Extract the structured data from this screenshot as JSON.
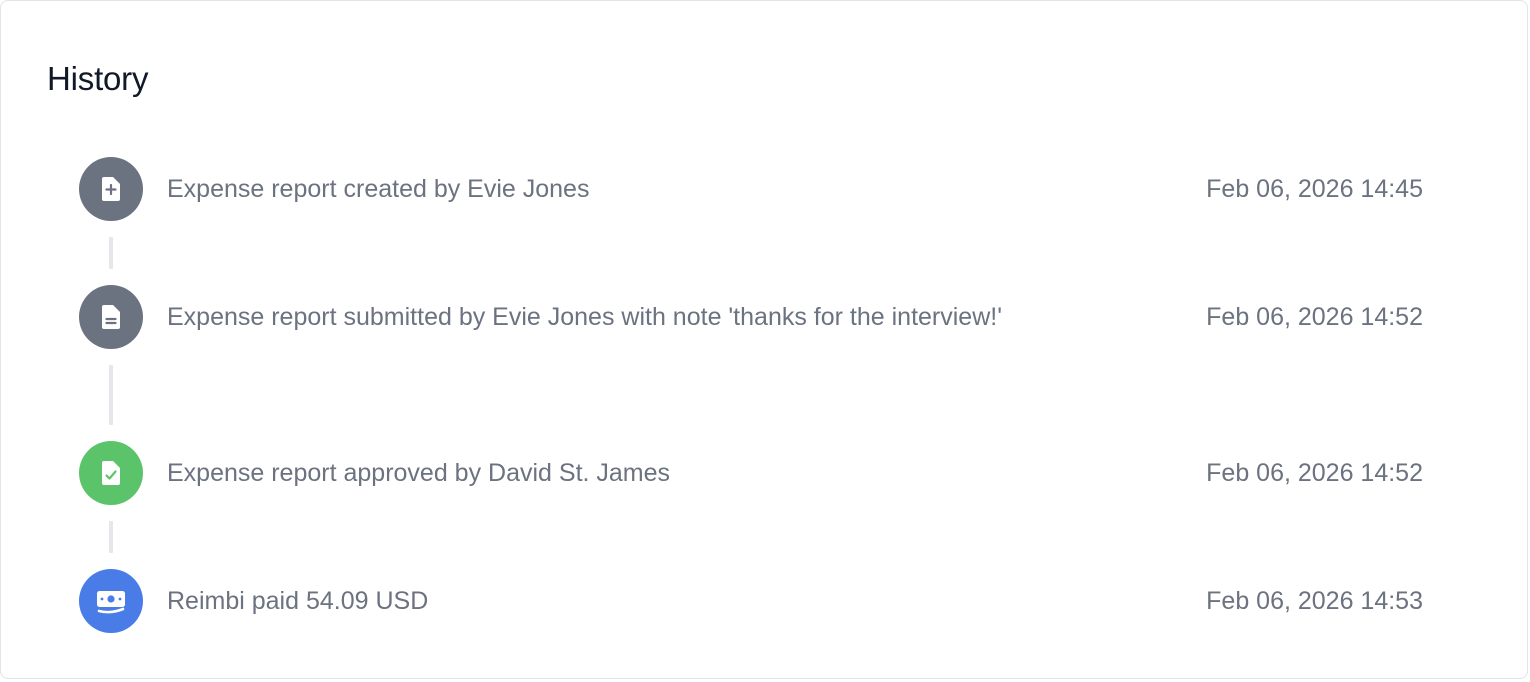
{
  "history": {
    "title": "History",
    "events": [
      {
        "text": "Expense report created by Evie Jones",
        "timestamp": "Feb 06, 2026 14:45",
        "icon": "document-add-icon",
        "icon_color": "#6b7280"
      },
      {
        "text": "Expense report submitted by Evie Jones with note 'thanks for the interview!'",
        "timestamp": "Feb 06, 2026 14:52",
        "icon": "document-text-icon",
        "icon_color": "#6b7280"
      },
      {
        "text": "Expense report approved by David St. James",
        "timestamp": "Feb 06, 2026 14:52",
        "icon": "document-check-icon",
        "icon_color": "#5bc46a"
      },
      {
        "text": "Reimbi paid 54.09 USD",
        "timestamp": "Feb 06, 2026 14:53",
        "icon": "cash-icon",
        "icon_color": "#4a7ce8"
      }
    ]
  }
}
